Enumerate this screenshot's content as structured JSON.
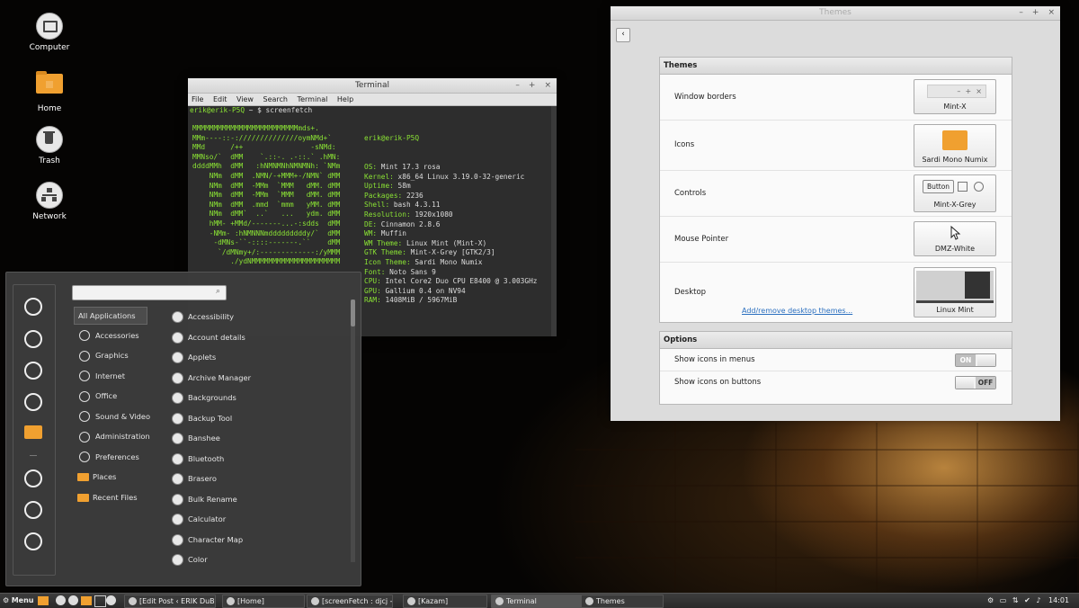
{
  "desktop": {
    "icons": [
      {
        "label": "Computer",
        "icon": "monitor-icon"
      },
      {
        "label": "Home",
        "icon": "home-folder-icon"
      },
      {
        "label": "Trash",
        "icon": "trash-icon"
      },
      {
        "label": "Network",
        "icon": "network-icon"
      }
    ]
  },
  "terminal": {
    "title": "Terminal",
    "menu": [
      "File",
      "Edit",
      "View",
      "Search",
      "Terminal",
      "Help"
    ],
    "prompt_user": "erik@erik-P5Q",
    "prompt_rest": " ~ $ screenfetch",
    "ascii_art": "MMMMMMMMMMMMMMMMMMMMMMMMMmds+.\nMMm----::-://////////////oymNMd+`\nMMd      /++                -sNMd:\nMMNso/`  dMM    `.::-. .-::.` .hMN:\nddddMMh  dMM   :hNMNMNhNMNMNh: `NMm\n    NMm  dMM  .NMN/-+MMM+-/NMN` dMM\n    NMm  dMM  -MMm  `MMM   dMM. dMM\n    NMm  dMM  -MMm  `MMM   dMM. dMM\n    NMm  dMM  .mmd  `mmm   yMM. dMM\n    NMm  dMM`  ..`   ...   ydm. dMM\n    hMM- +MMd/-------...-:sdds  dMM\n    -NMm- :hNMNNNmdddddddddy/`  dMM\n     -dMNs-``-::::-------.``    dMM\n      `/dMNmy+/:-------------:/yMMM\n         ./ydNMMMMMMMMMMMMMMMMMMMMM",
    "info_header": "erik@erik-P5Q",
    "info": [
      {
        "key": "OS:",
        "val": " Mint 17.3 rosa"
      },
      {
        "key": "Kernel:",
        "val": " x86_64 Linux 3.19.0-32-generic"
      },
      {
        "key": "Uptime:",
        "val": " 58m"
      },
      {
        "key": "Packages:",
        "val": " 2236"
      },
      {
        "key": "Shell:",
        "val": " bash 4.3.11"
      },
      {
        "key": "Resolution:",
        "val": " 1920x1080"
      },
      {
        "key": "DE:",
        "val": " Cinnamon 2.8.6"
      },
      {
        "key": "WM:",
        "val": " Muffin"
      },
      {
        "key": "WM Theme:",
        "val": " Linux Mint (Mint-X)"
      },
      {
        "key": "GTK Theme:",
        "val": " Mint-X-Grey [GTK2/3]"
      },
      {
        "key": "Icon Theme:",
        "val": " Sardi Mono Numix"
      },
      {
        "key": "Font:",
        "val": " Noto Sans 9"
      },
      {
        "key": "CPU:",
        "val": " Intel Core2 Duo CPU E8400 @ 3.003GHz"
      },
      {
        "key": "GPU:",
        "val": " Gallium 0.4 on NV94"
      },
      {
        "key": "RAM:",
        "val": " 1408MiB / 5967MiB"
      }
    ]
  },
  "themes": {
    "title": "Themes",
    "section_themes": "Themes",
    "rows": [
      {
        "label": "Window borders",
        "value": "Mint-X"
      },
      {
        "label": "Icons",
        "value": "Sardi Mono Numix"
      },
      {
        "label": "Controls",
        "value": "Mint-X-Grey",
        "button_label": "Button"
      },
      {
        "label": "Mouse Pointer",
        "value": "DMZ-White"
      },
      {
        "label": "Desktop",
        "value": "Linux Mint",
        "link": "Add/remove desktop themes..."
      }
    ],
    "section_options": "Options",
    "options": [
      {
        "label": "Show icons in menus",
        "state": "ON"
      },
      {
        "label": "Show icons on buttons",
        "state": "OFF"
      }
    ]
  },
  "menu": {
    "favorites": [
      "firefox-icon",
      "download-icon",
      "tools-icon",
      "money-icon",
      "folder-icon",
      "lock-icon",
      "logout-icon",
      "power-icon"
    ],
    "categories": [
      "All Applications",
      "Accessories",
      "Graphics",
      "Internet",
      "Office",
      "Sound & Video",
      "Administration",
      "Preferences",
      "Places",
      "Recent Files"
    ],
    "apps": [
      "Accessibility",
      "Account details",
      "Applets",
      "Archive Manager",
      "Backgrounds",
      "Backup Tool",
      "Banshee",
      "Bluetooth",
      "Brasero",
      "Bulk Rename",
      "Calculator",
      "Character Map",
      "Color"
    ]
  },
  "taskbar": {
    "menu_label": "Menu",
    "windows": [
      {
        "label": "[Edit Post ‹ ERIK DuB...",
        "active": false
      },
      {
        "label": "[Home]",
        "active": false
      },
      {
        "label": "[screenFetch : djcj - ...",
        "active": false
      },
      {
        "label": "[Kazam]",
        "active": false
      },
      {
        "label": "Terminal",
        "active": true
      },
      {
        "label": "Themes",
        "active": false
      }
    ],
    "clock": "14:01"
  },
  "colors": {
    "accent_green": "#8ae234",
    "folder_orange": "#f0a030",
    "link_blue": "#2a6fbf"
  }
}
